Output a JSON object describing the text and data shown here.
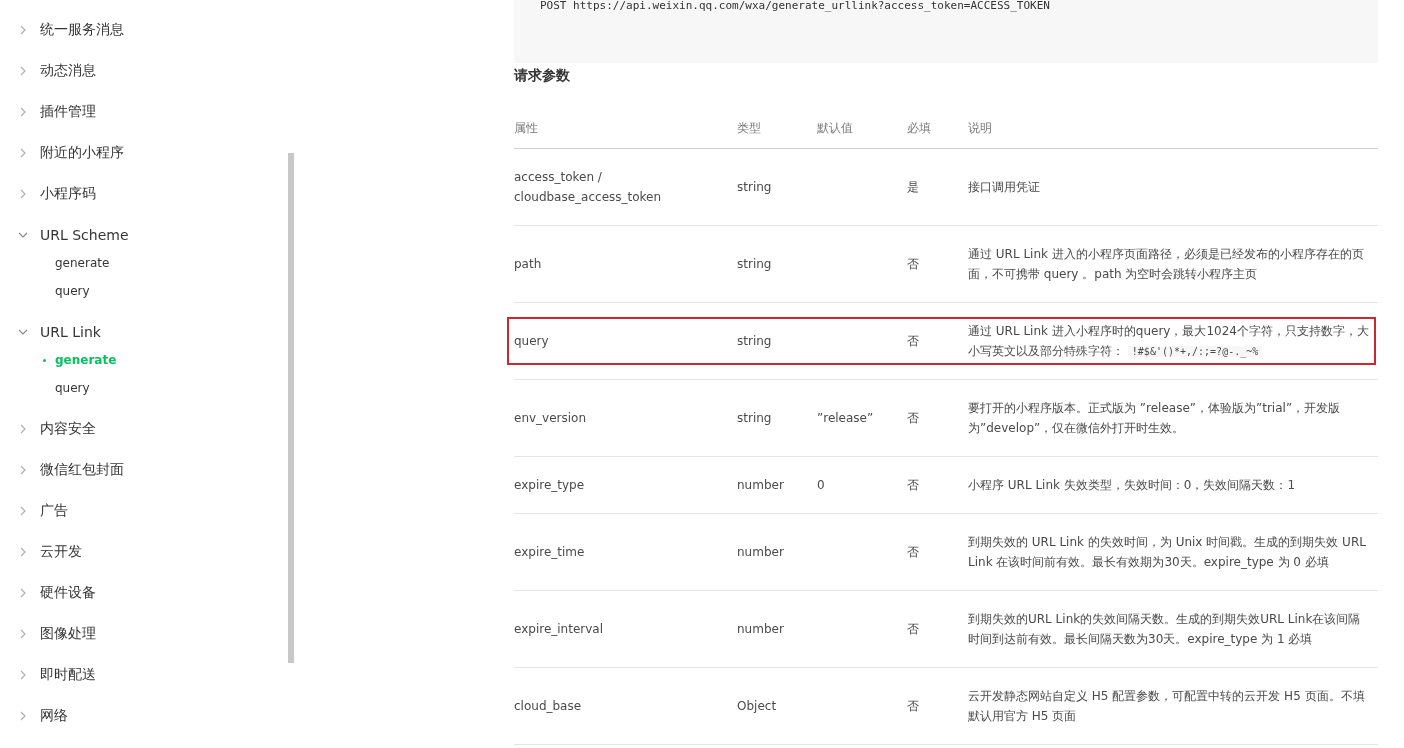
{
  "sidebar": {
    "items": [
      {
        "label": "统一服务消息",
        "expanded": false
      },
      {
        "label": "动态消息",
        "expanded": false
      },
      {
        "label": "插件管理",
        "expanded": false
      },
      {
        "label": "附近的小程序",
        "expanded": false
      },
      {
        "label": "小程序码",
        "expanded": false
      },
      {
        "label": "URL Scheme",
        "expanded": true,
        "children": [
          {
            "label": "generate",
            "selected": false
          },
          {
            "label": "query",
            "selected": false
          }
        ]
      },
      {
        "label": "URL Link",
        "expanded": true,
        "children": [
          {
            "label": "generate",
            "selected": true
          },
          {
            "label": "query",
            "selected": false
          }
        ]
      },
      {
        "label": "内容安全",
        "expanded": false
      },
      {
        "label": "微信红包封面",
        "expanded": false
      },
      {
        "label": "广告",
        "expanded": false
      },
      {
        "label": "云开发",
        "expanded": false
      },
      {
        "label": "硬件设备",
        "expanded": false
      },
      {
        "label": "图像处理",
        "expanded": false
      },
      {
        "label": "即时配送",
        "expanded": false
      },
      {
        "label": "网络",
        "expanded": false
      }
    ]
  },
  "code": "POST https://api.weixin.qq.com/wxa/generate_urllink?access_token=ACCESS_TOKEN",
  "section_title": "请求参数",
  "table": {
    "columns": [
      "属性",
      "类型",
      "默认值",
      "必填",
      "说明"
    ],
    "rows": [
      {
        "name": "access_token / cloudbase_access_token",
        "type": "string",
        "required": "是",
        "description": "接口调用凭证",
        "highlighted": false
      },
      {
        "name": "path",
        "type": "string",
        "required": "否",
        "description": "通过 URL Link 进入的小程序页面路径，必须是已经发布的小程序存在的页面，不可携带 query 。path 为空时会跳转小程序主页",
        "highlighted": false
      },
      {
        "name": "query",
        "type": "string",
        "required": "否",
        "description": "通过 URL Link 进入小程序时的query，最大1024个字符，只支持数字，大小写英文以及部分特殊字符：",
        "code": "!#$&'()*+,/:;=?@-._~%",
        "highlighted": true
      },
      {
        "name": "env_version",
        "type": "string",
        "default": "”release”",
        "required": "否",
        "description": "要打开的小程序版本。正式版为 ”release”，体验版为”trial”，开发版为”develop”，仅在微信外打开时生效。",
        "highlighted": false
      },
      {
        "name": "expire_type",
        "type": "number",
        "default": "0",
        "required": "否",
        "description": "小程序 URL Link 失效类型，失效时间：0，失效间隔天数：1",
        "highlighted": false
      },
      {
        "name": "expire_time",
        "type": "number",
        "required": "否",
        "description": "到期失效的 URL Link 的失效时间，为 Unix 时间戳。生成的到期失效 URL Link 在该时间前有效。最长有效期为30天。expire_type 为 0 必填",
        "highlighted": false
      },
      {
        "name": "expire_interval",
        "type": "number",
        "required": "否",
        "description": "到期失效的URL Link的失效间隔天数。生成的到期失效URL Link在该间隔时间到达前有效。最长间隔天数为30天。expire_type 为 1 必填",
        "highlighted": false
      },
      {
        "name": "cloud_base",
        "type": "Object",
        "required": "否",
        "description": "云开发静态网站自定义 H5 配置参数，可配置中转的云开发 H5 页面。不填默认用官方 H5 页面",
        "highlighted": false
      }
    ]
  }
}
